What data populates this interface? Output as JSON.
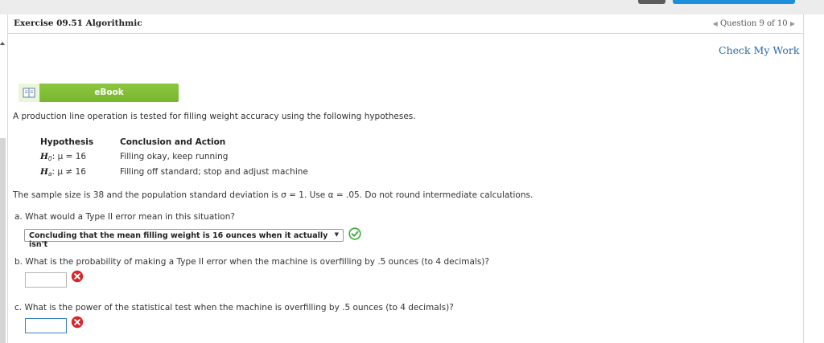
{
  "header": {
    "exercise_title": "Exercise 09.51 Algorithmic",
    "question_nav": "Question 9 of 10",
    "prev_arrow": "◀",
    "next_arrow": "▶",
    "check_work": "Check My Work"
  },
  "ebook": {
    "label": "eBook",
    "icon": "book-icon"
  },
  "problem": {
    "intro": "A production line operation is tested for filling weight accuracy using the following hypotheses.",
    "table": {
      "headers": [
        "Hypothesis",
        "Conclusion and Action"
      ],
      "rows": [
        {
          "h_main": "H",
          "h_sub": "0",
          "h_rest": ": μ = 16",
          "action": "Filling okay, keep running"
        },
        {
          "h_main": "H",
          "h_sub": "a",
          "h_rest": ": μ ≠ 16",
          "action": "Filling off standard; stop and adjust machine"
        }
      ]
    },
    "sample_text": "The sample size is 38 and the population standard deviation is σ = 1. Use α = .05. Do not round intermediate calculations."
  },
  "questions": {
    "a": {
      "text": "a. What would a Type II error mean in this situation?",
      "selected": "Concluding that the mean filling weight is 16 ounces when it actually isn't",
      "caret": "▼",
      "status": "correct-check-icon",
      "status_color": "#3aaa35"
    },
    "b": {
      "text": "b. What is the probability of making a Type II error when the machine is overfilling by .5 ounces (to 4 decimals)?",
      "value": "",
      "status": "incorrect-x-icon",
      "status_color": "#d9262b"
    },
    "c": {
      "text": "c. What is the power of the statistical test when the machine is overfilling by .5 ounces (to 4 decimals)?",
      "value": "",
      "status": "incorrect-x-icon",
      "status_color": "#d9262b"
    }
  },
  "colors": {
    "ebook_green": "#8cc63f",
    "link_blue": "#2b6aa8",
    "focus_blue": "#3d7fc1",
    "top_blue_button": "#1b8fd8"
  }
}
